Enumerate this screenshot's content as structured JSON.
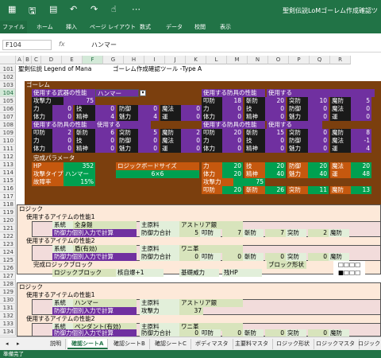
{
  "window": {
    "title": "聖剣伝説LoMゴーレム作成確認ツ"
  },
  "ribbon": {
    "tabs": [
      "ファイル",
      "ホーム",
      "挿入",
      "ページ レイアウト",
      "数式",
      "データ",
      "校閲",
      "表示"
    ]
  },
  "formula_bar": {
    "name_box": "F104",
    "value": "ハンマー"
  },
  "columns": [
    "A",
    "B",
    "C",
    "D",
    "E",
    "F",
    "G",
    "H",
    "I",
    "J",
    "K",
    "L",
    "M",
    "N",
    "O",
    "P",
    "Q",
    "R"
  ],
  "rows": [
    "101",
    "102",
    "103",
    "104",
    "105",
    "106",
    "107",
    "108",
    "109",
    "110",
    "111",
    "112",
    "113",
    "114",
    "115",
    "116",
    "117",
    "118",
    "119",
    "120",
    "121",
    "122",
    "123",
    "124",
    "125",
    "126",
    "127",
    "128",
    "129",
    "130",
    "131",
    "132",
    "133",
    "134"
  ],
  "sheet": {
    "title": "聖剣伝説 Legend of Mana",
    "tool_title": "ゴーレム作成確認ツール -Type A",
    "golem_header": "ゴーレム",
    "weapon_label": "使用する武器の性能",
    "weapon_value": "ハンマー",
    "armor1_label": "使用する防具の性能",
    "armor2_label": "使用する防具の性能",
    "armor3_label": "使用する防具の性能",
    "use": "使用する",
    "attack_label": "攻撃力",
    "attack_value": "75",
    "stat_rows": [
      {
        "a": "力",
        "av": "0",
        "b": "技",
        "bv": "0",
        "c": "防御",
        "cv": "0",
        "d": "魔法",
        "dv": "0"
      },
      {
        "a": "体力",
        "av": "0",
        "b": "精神",
        "bv": "4",
        "c": "魅力",
        "cv": "4",
        "d": "運",
        "dv": "0"
      }
    ],
    "armor1_rows": [
      {
        "a": "叩防",
        "av": "18",
        "b": "斬防",
        "bv": "20",
        "c": "突防",
        "cv": "10",
        "d": "魔防",
        "dv": "5"
      },
      {
        "a": "力",
        "av": "0",
        "b": "技",
        "bv": "0",
        "c": "防御",
        "cv": "0",
        "d": "魔法",
        "dv": "0"
      },
      {
        "a": "体力",
        "av": "0",
        "b": "精神",
        "bv": "0",
        "c": "魅力",
        "cv": "0",
        "d": "運",
        "dv": "0"
      }
    ],
    "armor2_rows": [
      {
        "a": "叩防",
        "av": "2",
        "b": "斬防",
        "bv": "6",
        "c": "突防",
        "cv": "5",
        "d": "魔防",
        "dv": "2"
      },
      {
        "a": "力",
        "av": "0",
        "b": "技",
        "bv": "0",
        "c": "防御",
        "cv": "0",
        "d": "魔法",
        "dv": "0"
      },
      {
        "a": "体力",
        "av": "0",
        "b": "精神",
        "bv": "0",
        "c": "魅力",
        "cv": "0",
        "d": "運",
        "dv": "0"
      }
    ],
    "armor3_rows": [
      {
        "a": "叩防",
        "av": "20",
        "b": "斬防",
        "bv": "15",
        "c": "突防",
        "cv": "0",
        "d": "魔防",
        "dv": "8"
      },
      {
        "a": "力",
        "av": "0",
        "b": "技",
        "bv": "0",
        "c": "防御",
        "cv": "0",
        "d": "魔法",
        "dv": "-1"
      },
      {
        "a": "体力",
        "av": "0",
        "b": "精神",
        "bv": "0",
        "c": "魅力",
        "cv": "0",
        "d": "運",
        "dv": "4"
      }
    ],
    "complete_params": "完成パラメータ",
    "hp_label": "HP",
    "hp_value": "352",
    "board_label": "ロジックボードサイズ",
    "board_value": "6×6",
    "atk_type_label": "攻撃タイプ",
    "atk_type_value": "ハンマー",
    "fail_label": "故障率",
    "fail_value": "15%",
    "final_rows": [
      {
        "a": "力",
        "av": "20",
        "b": "技",
        "bv": "20",
        "c": "防御",
        "cv": "20",
        "d": "魔法",
        "dv": "20"
      },
      {
        "a": "体力",
        "av": "20",
        "b": "精神",
        "bv": "40",
        "c": "魅力",
        "cv": "40",
        "d": "運",
        "dv": "48"
      }
    ],
    "final_atk_label": "攻撃力",
    "final_atk_value": "75",
    "final_def": {
      "a": "叩防",
      "av": "20",
      "b": "斬防",
      "bv": "26",
      "c": "突防",
      "cv": "11",
      "d": "魔防",
      "dv": "13"
    },
    "logic_header": "ロジック",
    "item1_label": "使用するアイテムの性能1",
    "item2_label": "使用するアイテムの性能2",
    "lineage": "系統",
    "lineage1": "全身鎧",
    "material": "主原料",
    "material1": "アストリア銀",
    "individual": "防御力個別入力で計算",
    "def_total": "防御力合計",
    "item1_def": {
      "a": "叩防",
      "av": "5",
      "b": "斬防",
      "bv": "7",
      "c": "突防",
      "cv": "7",
      "d": "魔防",
      "dv": "2"
    },
    "lineage2": "盾(有効)",
    "material2": "ワニ革",
    "item2_def": {
      "av": "0",
      "bv": "0",
      "cv": "0",
      "dv": "0"
    },
    "logic_block_label": "完成ロジックブロック",
    "block_shape_label": "ブロック形状",
    "logic_block": "ロジックブロック",
    "kaku": "核自爆+1",
    "base_power": "基礎威力",
    "rem_hp": "残HP",
    "shape_row1": "□□□□",
    "shape_row2": "■□□□",
    "item1b_lineage": "ハンマー",
    "item1b_material": "アストリア銀",
    "item1b_atk_label": "攻撃力",
    "item1b_atk": "37",
    "item2b_lineage": "ペンダント(有効)",
    "item2b_material": "ワニ革",
    "item2b_def": {
      "av": "0",
      "bv": "0",
      "cv": "0",
      "dv": "0"
    }
  },
  "sheet_tabs": [
    "説明",
    "確認シートA",
    "確認シートB",
    "確認シートC",
    "ボディマスタ",
    "主要料マスタ",
    "ロジック形状",
    "ロジックマスタ",
    "ロジックラ"
  ],
  "active_tab": "確認シートA",
  "status": "準備完了"
}
